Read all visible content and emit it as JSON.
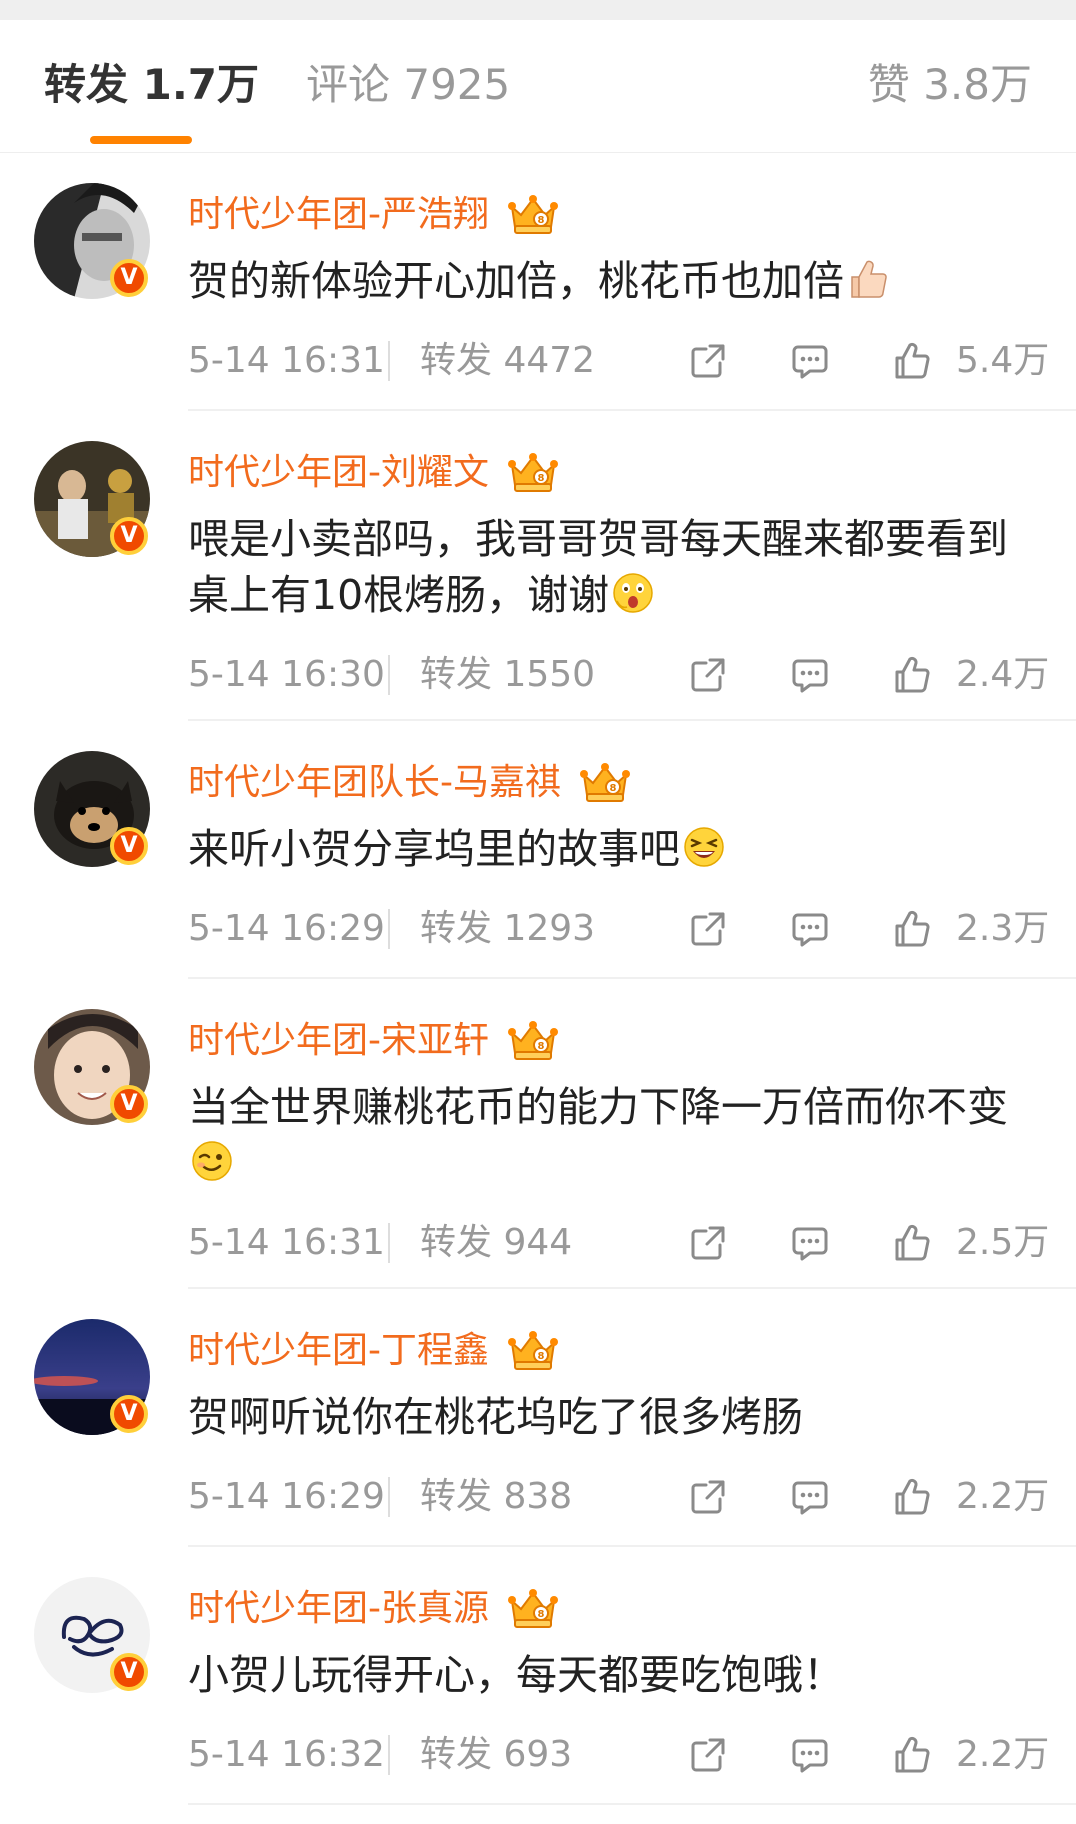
{
  "tabs": {
    "reposts": "转发 1.7万",
    "comments": "评论 7925",
    "likes": "赞 3.8万"
  },
  "colors": {
    "accent": "#ff8200",
    "username": "#f26b1d",
    "badge": "#f04a00"
  },
  "badge_letter": "V",
  "comments": [
    {
      "username": "时代少年团-严浩翔",
      "text": "贺的新体验开心加倍，桃花币也加倍",
      "emoji": "thumbs-up-emoji",
      "time": "5-14 16:31",
      "reposts": "转发 4472",
      "likes": "5.4万"
    },
    {
      "username": "时代少年团-刘耀文",
      "text": "喂是小卖部吗，我哥哥贺哥每天醒来都要看到桌上有10根烤肠，谢谢",
      "emoji": "surprised-emoji",
      "time": "5-14 16:30",
      "reposts": "转发 1550",
      "likes": "2.4万"
    },
    {
      "username": "时代少年团队长-马嘉祺",
      "text": "来听小贺分享坞里的故事吧",
      "emoji": "laughing-emoji",
      "time": "5-14 16:29",
      "reposts": "转发 1293",
      "likes": "2.3万"
    },
    {
      "username": "时代少年团-宋亚轩",
      "text": "当全世界赚桃花币的能力下降一万倍而你不变",
      "emoji": "wink-emoji",
      "time": "5-14 16:31",
      "reposts": "转发 944",
      "likes": "2.5万"
    },
    {
      "username": "时代少年团-丁程鑫",
      "text": "贺啊听说你在桃花坞吃了很多烤肠",
      "time": "5-14 16:29",
      "reposts": "转发 838",
      "likes": "2.2万"
    },
    {
      "username": "时代少年团-张真源",
      "text": "小贺儿玩得开心，每天都要吃饱哦！",
      "time": "5-14 16:32",
      "reposts": "转发 693",
      "likes": "2.2万"
    }
  ]
}
